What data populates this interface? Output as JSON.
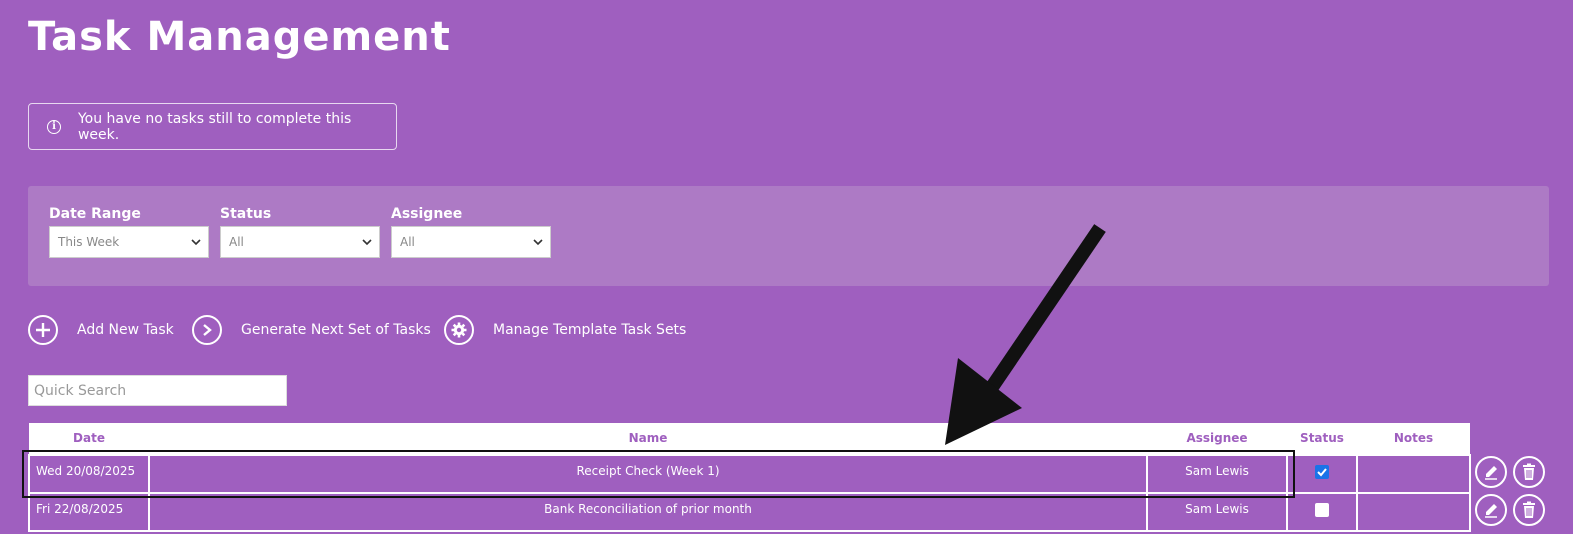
{
  "page": {
    "title": "Task Management"
  },
  "info": {
    "message": "You have no tasks still to complete this week."
  },
  "filters": {
    "date_range": {
      "label": "Date Range",
      "value": "This Week"
    },
    "status": {
      "label": "Status",
      "value": "All"
    },
    "assignee": {
      "label": "Assignee",
      "value": "All"
    }
  },
  "actions": {
    "add": "Add New Task",
    "generate": "Generate Next Set of Tasks",
    "manage": "Manage Template Task Sets"
  },
  "search": {
    "placeholder": "Quick Search"
  },
  "table": {
    "headers": {
      "date": "Date",
      "name": "Name",
      "assignee": "Assignee",
      "status": "Status",
      "notes": "Notes"
    },
    "rows": [
      {
        "date": "Wed 20/08/2025",
        "name": "Receipt Check (Week 1)",
        "assignee": "Sam Lewis",
        "completed": true,
        "notes": ""
      },
      {
        "date": "Fri 22/08/2025",
        "name": "Bank Reconciliation of prior month",
        "assignee": "Sam Lewis",
        "completed": false,
        "notes": ""
      }
    ]
  },
  "colors": {
    "background": "#9f5fbf",
    "panel": "#ad7ac5",
    "checkbox_checked": "#1a73e8",
    "highlight": "#111111"
  },
  "icons": [
    "info-icon",
    "chevron-down-icon",
    "plus-icon",
    "chevron-right-icon",
    "gear-icon",
    "edit-icon",
    "trash-icon",
    "arrow-annotation"
  ]
}
